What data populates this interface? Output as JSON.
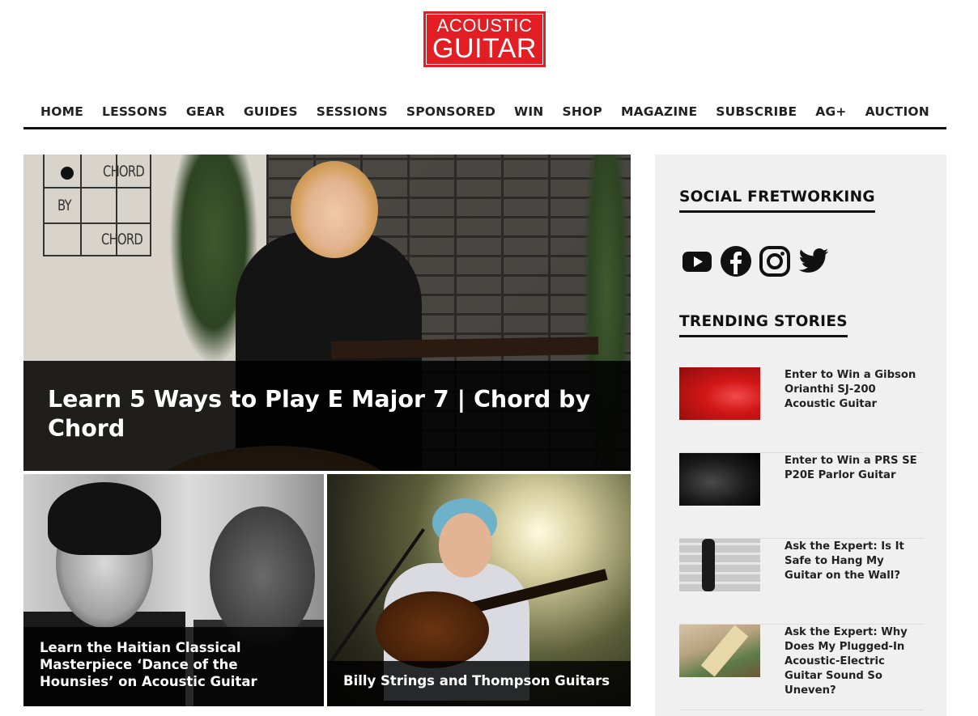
{
  "logo": {
    "line1": "ACOUSTIC",
    "line2": "GUITAR",
    "color": "#e21d23"
  },
  "nav": {
    "items": [
      {
        "label": "HOME"
      },
      {
        "label": "LESSONS"
      },
      {
        "label": "GEAR"
      },
      {
        "label": "GUIDES"
      },
      {
        "label": "SESSIONS"
      },
      {
        "label": "SPONSORED"
      },
      {
        "label": "WIN"
      },
      {
        "label": "SHOP"
      },
      {
        "label": "MAGAZINE"
      },
      {
        "label": "SUBSCRIBE"
      },
      {
        "label": "AG+"
      },
      {
        "label": "AUCTION"
      }
    ]
  },
  "hero": {
    "title": "Learn 5 Ways to Play E Major 7 | Chord by Chord",
    "chord_logo": {
      "top": "CHORD",
      "middle": "BY",
      "bottom": "CHORD"
    }
  },
  "cards": [
    {
      "title": "Learn the Haitian Classical Masterpiece ‘Dance of the Hounsies’ on Acoustic Guitar"
    },
    {
      "title": "Billy Strings and Thompson Guitars"
    }
  ],
  "sidebar": {
    "social_heading": "SOCIAL FRETWORKING",
    "social_icons": [
      "youtube-icon",
      "facebook-icon",
      "instagram-icon",
      "twitter-icon"
    ],
    "trending_heading": "TRENDING STORIES",
    "trending": [
      {
        "title": "Enter to Win a Gibson Orianthi SJ-200 Acoustic Guitar"
      },
      {
        "title": "Enter to Win a PRS SE P20E Parlor Guitar"
      },
      {
        "title": "Ask the Expert: Is It Safe to Hang My Guitar on the Wall?"
      },
      {
        "title": "Ask the Expert: Why Does My Plugged-In Acoustic-Electric Guitar Sound So Uneven?"
      }
    ]
  }
}
